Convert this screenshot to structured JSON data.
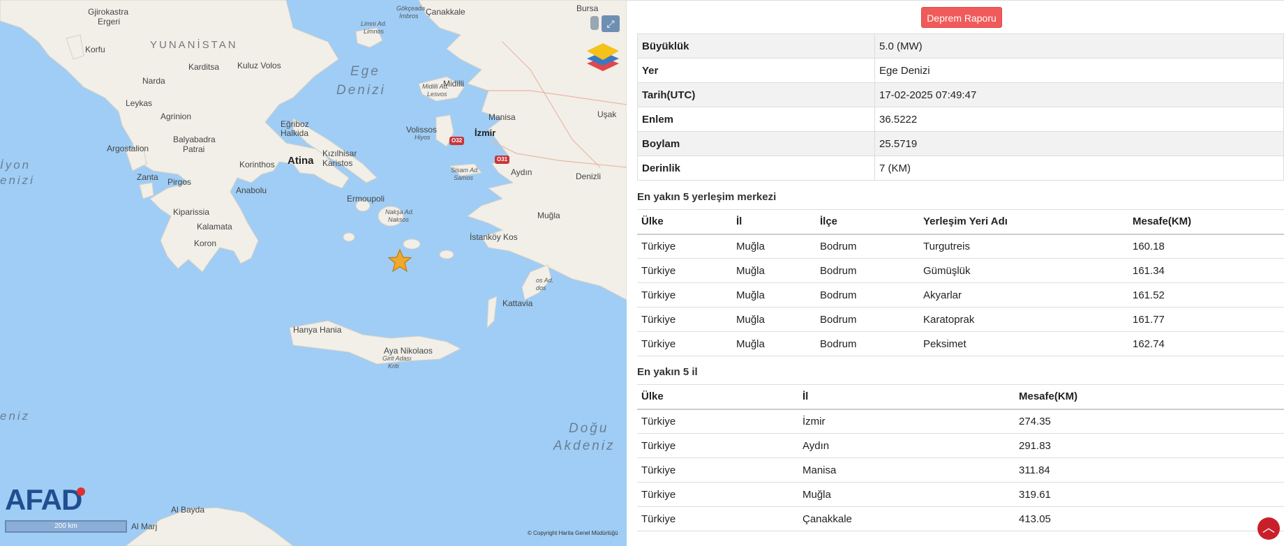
{
  "map": {
    "places": [
      {
        "name": "Gjirokastra",
        "cls": ""
      },
      {
        "name": "Ergeri",
        "cls": ""
      },
      {
        "name": "Korfu",
        "cls": ""
      },
      {
        "name": "YUNANİSTAN",
        "cls": "country"
      },
      {
        "name": "Karditsa",
        "cls": ""
      },
      {
        "name": "Kuluz Volos",
        "cls": ""
      },
      {
        "name": "Narda",
        "cls": ""
      },
      {
        "name": "Leykas",
        "cls": ""
      },
      {
        "name": "Agrinion",
        "cls": ""
      },
      {
        "name": "Balyabadra",
        "cls": ""
      },
      {
        "name": "Patrai",
        "cls": ""
      },
      {
        "name": "Argostalion",
        "cls": ""
      },
      {
        "name": "Eğriboz",
        "cls": ""
      },
      {
        "name": "Halkida",
        "cls": ""
      },
      {
        "name": "Atina",
        "cls": "capital"
      },
      {
        "name": "Korinthos",
        "cls": ""
      },
      {
        "name": "Kızılhisar",
        "cls": ""
      },
      {
        "name": "Karistos",
        "cls": ""
      },
      {
        "name": "Zanta",
        "cls": ""
      },
      {
        "name": "Pirgos",
        "cls": ""
      },
      {
        "name": "Anabolu",
        "cls": ""
      },
      {
        "name": "Kiparissia",
        "cls": ""
      },
      {
        "name": "Kalamata",
        "cls": ""
      },
      {
        "name": "Koron",
        "cls": ""
      },
      {
        "name": "Ermoupoli",
        "cls": ""
      },
      {
        "name": "Ege",
        "cls": "sea"
      },
      {
        "name": "Denizi",
        "cls": "sea"
      },
      {
        "name": "Gökçeada",
        "cls": "sm"
      },
      {
        "name": "İmbros",
        "cls": "sm"
      },
      {
        "name": "Çanakkale",
        "cls": ""
      },
      {
        "name": "Bursa",
        "cls": ""
      },
      {
        "name": "Limni Ad.",
        "cls": "sm"
      },
      {
        "name": "Limnos",
        "cls": "sm"
      },
      {
        "name": "Midilli",
        "cls": ""
      },
      {
        "name": "Midilli Ad.",
        "cls": "sm"
      },
      {
        "name": "Lesvos",
        "cls": "sm"
      },
      {
        "name": "Manisa",
        "cls": ""
      },
      {
        "name": "İzmir",
        "cls": "capital-sm"
      },
      {
        "name": "Uşak",
        "cls": ""
      },
      {
        "name": "Volissos",
        "cls": ""
      },
      {
        "name": "Hiyos",
        "cls": "sm"
      },
      {
        "name": "Aydın",
        "cls": ""
      },
      {
        "name": "Sisam Ad.",
        "cls": "sm"
      },
      {
        "name": "Samos",
        "cls": "sm"
      },
      {
        "name": "Denizli",
        "cls": ""
      },
      {
        "name": "Nakşa Ad.",
        "cls": "sm"
      },
      {
        "name": "Naksos",
        "cls": "sm"
      },
      {
        "name": "Muğla",
        "cls": ""
      },
      {
        "name": "İstanköy Kos",
        "cls": ""
      },
      {
        "name": "os Ad.",
        "cls": "sm"
      },
      {
        "name": "dos",
        "cls": "sm"
      },
      {
        "name": "Kattavia",
        "cls": ""
      },
      {
        "name": "Hanya Hania",
        "cls": ""
      },
      {
        "name": "Aya Nikolaos",
        "cls": ""
      },
      {
        "name": "Girit Adası",
        "cls": "sm"
      },
      {
        "name": "Kriti",
        "cls": "sm"
      },
      {
        "name": "İyon",
        "cls": "sea"
      },
      {
        "name": "enizi",
        "cls": "sea"
      },
      {
        "name": "eniz",
        "cls": "sea"
      },
      {
        "name": "Doğu",
        "cls": "sea"
      },
      {
        "name": "Akdeniz",
        "cls": "sea"
      },
      {
        "name": "Al Bayda",
        "cls": ""
      },
      {
        "name": "Al Marj",
        "cls": ""
      }
    ],
    "road_badges": [
      "O32",
      "O31"
    ],
    "logo": "AFAD",
    "scale_label": "200 km",
    "copyright": "© Copyright Harita Genel Müdürlüğü",
    "colors": {
      "sea": "#9fcdf5",
      "land": "#f1efe8",
      "star": "#f0a92a"
    }
  },
  "panel": {
    "report_button": "Deprem Raporu",
    "summary": [
      {
        "key": "Büyüklük",
        "value": "5.0 (MW)"
      },
      {
        "key": "Yer",
        "value": "Ege Denizi"
      },
      {
        "key": "Tarih(UTC)",
        "value": "17-02-2025 07:49:47"
      },
      {
        "key": "Enlem",
        "value": "36.5222"
      },
      {
        "key": "Boylam",
        "value": "25.5719"
      },
      {
        "key": "Derinlik",
        "value": "7 (KM)"
      }
    ],
    "settlements_title": "En yakın 5 yerleşim merkezi",
    "settlements_headers": [
      "Ülke",
      "İl",
      "İlçe",
      "Yerleşim Yeri Adı",
      "Mesafe(KM)"
    ],
    "settlements": [
      [
        "Türkiye",
        "Muğla",
        "Bodrum",
        "Turgutreis",
        "160.18"
      ],
      [
        "Türkiye",
        "Muğla",
        "Bodrum",
        "Gümüşlük",
        "161.34"
      ],
      [
        "Türkiye",
        "Muğla",
        "Bodrum",
        "Akyarlar",
        "161.52"
      ],
      [
        "Türkiye",
        "Muğla",
        "Bodrum",
        "Karatoprak",
        "161.77"
      ],
      [
        "Türkiye",
        "Muğla",
        "Bodrum",
        "Peksimet",
        "162.74"
      ]
    ],
    "provinces_title": "En yakın 5 il",
    "provinces_headers": [
      "Ülke",
      "İl",
      "Mesafe(KM)"
    ],
    "provinces": [
      [
        "Türkiye",
        "İzmir",
        "274.35"
      ],
      [
        "Türkiye",
        "Aydın",
        "291.83"
      ],
      [
        "Türkiye",
        "Manisa",
        "311.84"
      ],
      [
        "Türkiye",
        "Muğla",
        "319.61"
      ],
      [
        "Türkiye",
        "Çanakkale",
        "413.05"
      ]
    ]
  }
}
